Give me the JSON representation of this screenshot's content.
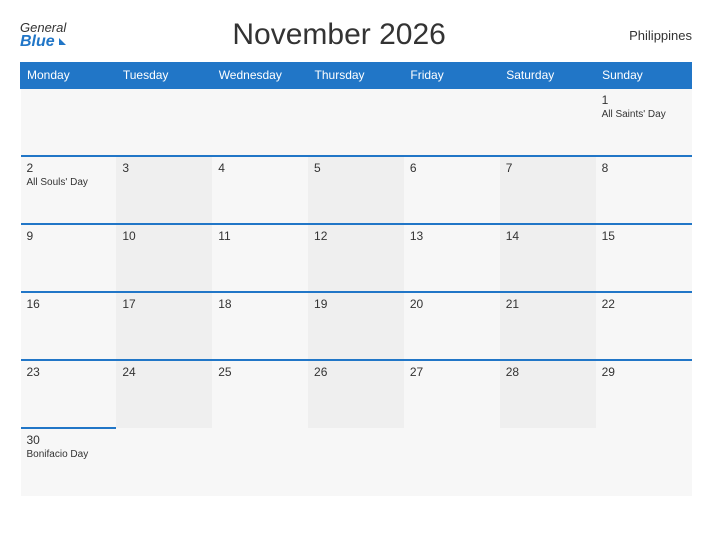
{
  "header": {
    "logo_general": "General",
    "logo_blue": "Blue",
    "month_title": "November 2026",
    "country": "Philippines"
  },
  "weekdays": [
    "Monday",
    "Tuesday",
    "Wednesday",
    "Thursday",
    "Friday",
    "Saturday",
    "Sunday"
  ],
  "weeks": [
    [
      {
        "day": "",
        "holiday": ""
      },
      {
        "day": "",
        "holiday": ""
      },
      {
        "day": "",
        "holiday": ""
      },
      {
        "day": "",
        "holiday": ""
      },
      {
        "day": "",
        "holiday": ""
      },
      {
        "day": "",
        "holiday": ""
      },
      {
        "day": "1",
        "holiday": "All Saints' Day"
      }
    ],
    [
      {
        "day": "2",
        "holiday": "All Souls' Day"
      },
      {
        "day": "3",
        "holiday": ""
      },
      {
        "day": "4",
        "holiday": ""
      },
      {
        "day": "5",
        "holiday": ""
      },
      {
        "day": "6",
        "holiday": ""
      },
      {
        "day": "7",
        "holiday": ""
      },
      {
        "day": "8",
        "holiday": ""
      }
    ],
    [
      {
        "day": "9",
        "holiday": ""
      },
      {
        "day": "10",
        "holiday": ""
      },
      {
        "day": "11",
        "holiday": ""
      },
      {
        "day": "12",
        "holiday": ""
      },
      {
        "day": "13",
        "holiday": ""
      },
      {
        "day": "14",
        "holiday": ""
      },
      {
        "day": "15",
        "holiday": ""
      }
    ],
    [
      {
        "day": "16",
        "holiday": ""
      },
      {
        "day": "17",
        "holiday": ""
      },
      {
        "day": "18",
        "holiday": ""
      },
      {
        "day": "19",
        "holiday": ""
      },
      {
        "day": "20",
        "holiday": ""
      },
      {
        "day": "21",
        "holiday": ""
      },
      {
        "day": "22",
        "holiday": ""
      }
    ],
    [
      {
        "day": "23",
        "holiday": ""
      },
      {
        "day": "24",
        "holiday": ""
      },
      {
        "day": "25",
        "holiday": ""
      },
      {
        "day": "26",
        "holiday": ""
      },
      {
        "day": "27",
        "holiday": ""
      },
      {
        "day": "28",
        "holiday": ""
      },
      {
        "day": "29",
        "holiday": ""
      }
    ],
    [
      {
        "day": "30",
        "holiday": "Bonifacio Day"
      },
      {
        "day": "",
        "holiday": ""
      },
      {
        "day": "",
        "holiday": ""
      },
      {
        "day": "",
        "holiday": ""
      },
      {
        "day": "",
        "holiday": ""
      },
      {
        "day": "",
        "holiday": ""
      },
      {
        "day": "",
        "holiday": ""
      }
    ]
  ]
}
